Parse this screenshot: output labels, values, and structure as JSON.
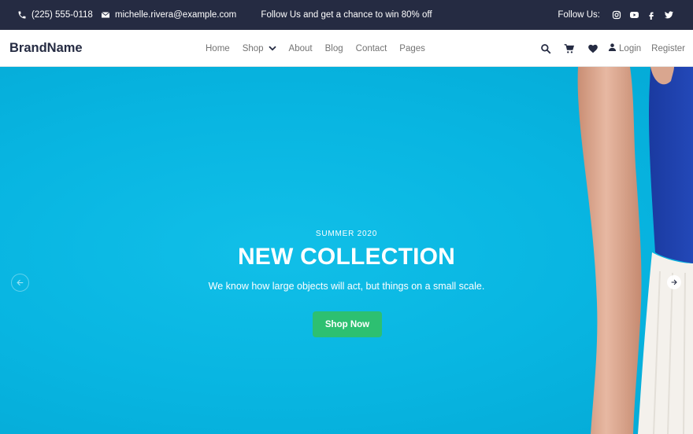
{
  "colors": {
    "topbar_bg": "#252B42",
    "hero_bg": "#08B5E1",
    "button_bg": "#2DC071",
    "nav_text": "#737373",
    "brand_text": "#252B42"
  },
  "topbar": {
    "phone": "(225) 555-0118",
    "email": "michelle.rivera@example.com",
    "promo": "Follow Us and get a chance to win 80% off",
    "follow_label": "Follow Us:",
    "social_icons": [
      "instagram-icon",
      "youtube-icon",
      "facebook-icon",
      "twitter-icon"
    ]
  },
  "navbar": {
    "brand": "BrandName",
    "menu": [
      "Home",
      "Shop",
      "About",
      "Blog",
      "Contact",
      "Pages"
    ],
    "login": "Login",
    "register": "Register",
    "action_icons": [
      "search-icon",
      "cart-icon",
      "heart-icon",
      "user-icon"
    ]
  },
  "hero": {
    "kicker": "SUMMER 2020",
    "headline": "NEW COLLECTION",
    "subtitle": "We know how large objects will act, but things on a small scale.",
    "cta": "Shop Now"
  }
}
